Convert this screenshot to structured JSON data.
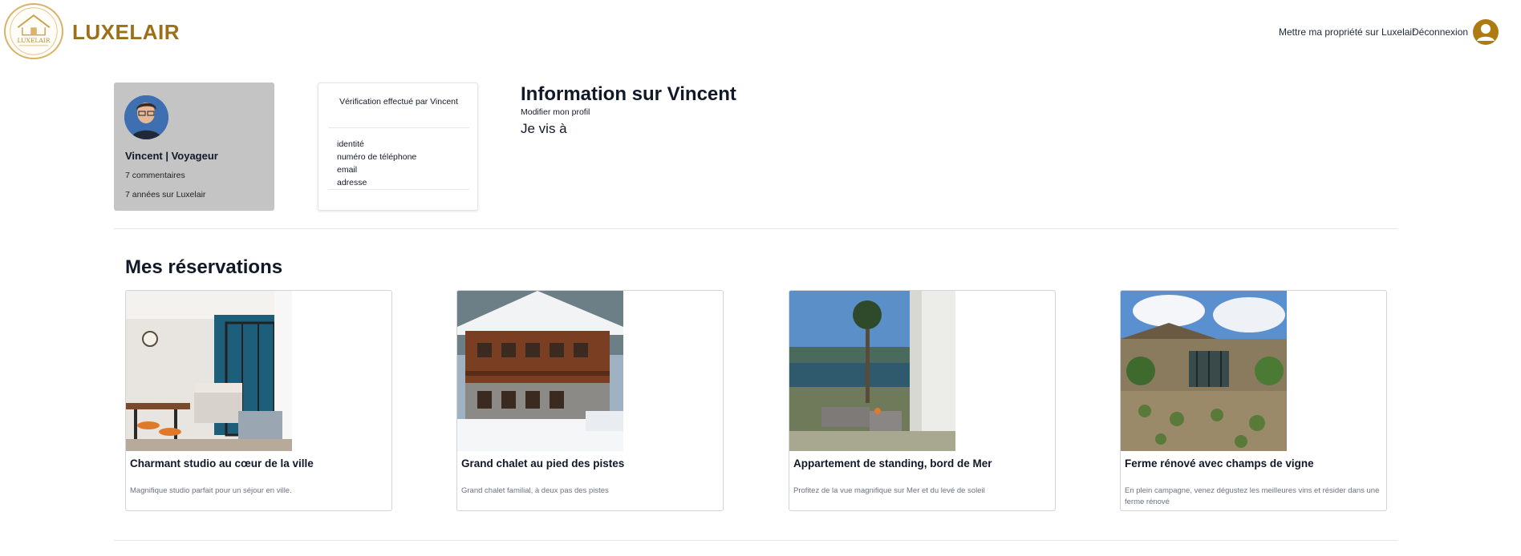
{
  "header": {
    "brand": "LUXELAIR",
    "logo_text": "LUXELAIR",
    "host_link": "Mettre ma propriété sur Luxelair",
    "logout_link": "Déconnexion",
    "accent_color": "#9b7019"
  },
  "profile": {
    "name": "Vincent | Voyageur",
    "comments": "7 commentaires",
    "years": "7 années sur Luxelair"
  },
  "verification": {
    "title": "Vérification effectué par Vincent",
    "items": [
      "identité",
      "numéro de téléphone",
      "email",
      "adresse"
    ]
  },
  "info": {
    "title": "Information sur Vincent",
    "edit_link": "Modifier mon profil",
    "lives_in": "Je vis à"
  },
  "reservations": {
    "title": "Mes réservations",
    "items": [
      {
        "title": "Charmant studio au cœur de la ville",
        "description": "Magnifique studio parfait pour un séjour en ville."
      },
      {
        "title": "Grand chalet au pied des pistes",
        "description": "Grand chalet familial, à deux pas des pistes"
      },
      {
        "title": "Appartement de standing, bord de Mer",
        "description": "Profitez de la vue magnifique sur Mer et du levé de soleil"
      },
      {
        "title": "Ferme rénové avec champs de vigne",
        "description": "En plein campagne, venez dégustez les meilleures vins et résider dans une ferme rénové"
      }
    ]
  }
}
